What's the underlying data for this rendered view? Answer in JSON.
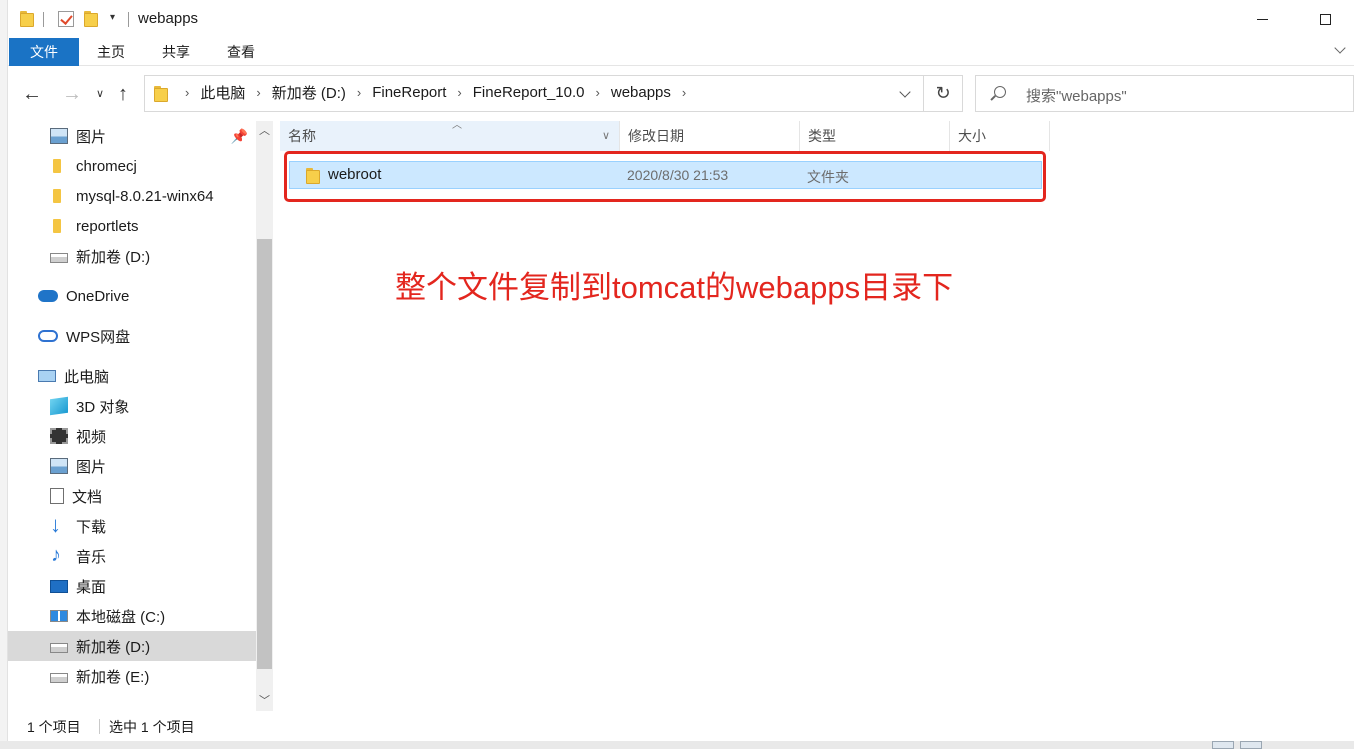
{
  "window": {
    "title": "webapps"
  },
  "ribbon": {
    "tabs": [
      "文件",
      "主页",
      "共享",
      "查看"
    ]
  },
  "address": {
    "crumbs": [
      "此电脑",
      "新加卷 (D:)",
      "FineReport",
      "FineReport_10.0",
      "webapps"
    ],
    "search_placeholder": "搜索\"webapps\""
  },
  "sidebar": {
    "items": [
      {
        "label": "图片",
        "icon": "pictures-icon"
      },
      {
        "label": "chromecj",
        "icon": "folder-icon"
      },
      {
        "label": "mysql-8.0.21-winx64",
        "icon": "folder-icon"
      },
      {
        "label": "reportlets",
        "icon": "folder-icon"
      },
      {
        "label": "新加卷 (D:)",
        "icon": "drive-icon"
      },
      {
        "label": "OneDrive",
        "icon": "onedrive-icon"
      },
      {
        "label": "WPS网盘",
        "icon": "wps-cloud-icon"
      },
      {
        "label": "此电脑",
        "icon": "this-pc-icon"
      },
      {
        "label": "3D 对象",
        "icon": "3d-objects-icon"
      },
      {
        "label": "视频",
        "icon": "videos-icon"
      },
      {
        "label": "图片",
        "icon": "pictures-icon"
      },
      {
        "label": "文档",
        "icon": "documents-icon"
      },
      {
        "label": "下载",
        "icon": "downloads-icon"
      },
      {
        "label": "音乐",
        "icon": "music-icon"
      },
      {
        "label": "桌面",
        "icon": "desktop-icon"
      },
      {
        "label": "本地磁盘 (C:)",
        "icon": "windows-drive-icon"
      },
      {
        "label": "新加卷 (D:)",
        "icon": "drive-icon"
      },
      {
        "label": "新加卷 (E:)",
        "icon": "drive-icon"
      }
    ]
  },
  "columns": {
    "name": "名称",
    "date": "修改日期",
    "type": "类型",
    "size": "大小"
  },
  "files": [
    {
      "name": "webroot",
      "date": "2020/8/30 21:53",
      "type": "文件夹",
      "size": ""
    }
  ],
  "annotation": "整个文件复制到tomcat的webapps目录下",
  "status": {
    "count": "1 个项目",
    "selected": "选中 1 个项目"
  },
  "colors": {
    "accent": "#1a73c5",
    "selection": "#cce8ff",
    "annotation": "#e3261e"
  }
}
